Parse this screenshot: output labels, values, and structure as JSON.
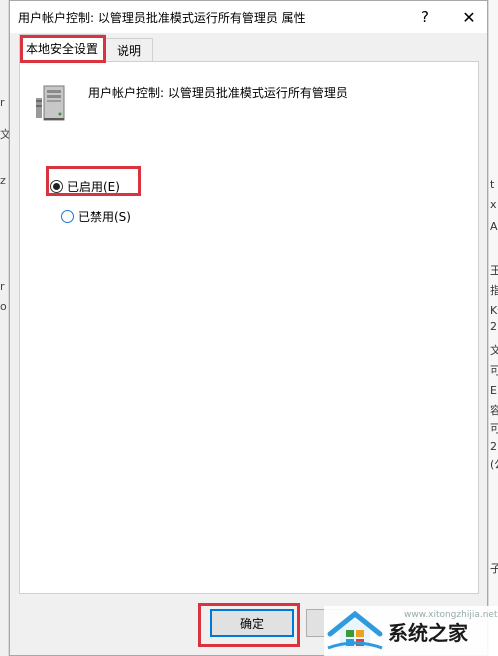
{
  "dialog": {
    "title": "用户帐户控制: 以管理员批准模式运行所有管理员 属性",
    "help_label": "?",
    "close_label": "✕"
  },
  "tabs": [
    {
      "label": "本地安全设置",
      "active": true
    },
    {
      "label": "说明",
      "active": false
    }
  ],
  "policy": {
    "icon": "server-computer-icon",
    "title": "用户帐户控制: 以管理员批准模式运行所有管理员"
  },
  "options": {
    "enabled_label": "已启用(E)",
    "disabled_label": "已禁用(S)",
    "selected": "enabled"
  },
  "buttons": {
    "ok_label": "确定"
  },
  "background_fragments": {
    "left": [
      "r",
      "文",
      "z",
      "r",
      "o"
    ],
    "right": [
      "t",
      "x",
      "A",
      "王",
      "指",
      "K件",
      "2",
      "文件",
      "可",
      "E",
      "容",
      "可",
      "2",
      "(公",
      "子"
    ]
  },
  "watermark": {
    "text": "系统之家",
    "url": "www.xitongzhijia.net"
  },
  "colors": {
    "highlight": "#d9333f",
    "accent": "#0078d7"
  }
}
